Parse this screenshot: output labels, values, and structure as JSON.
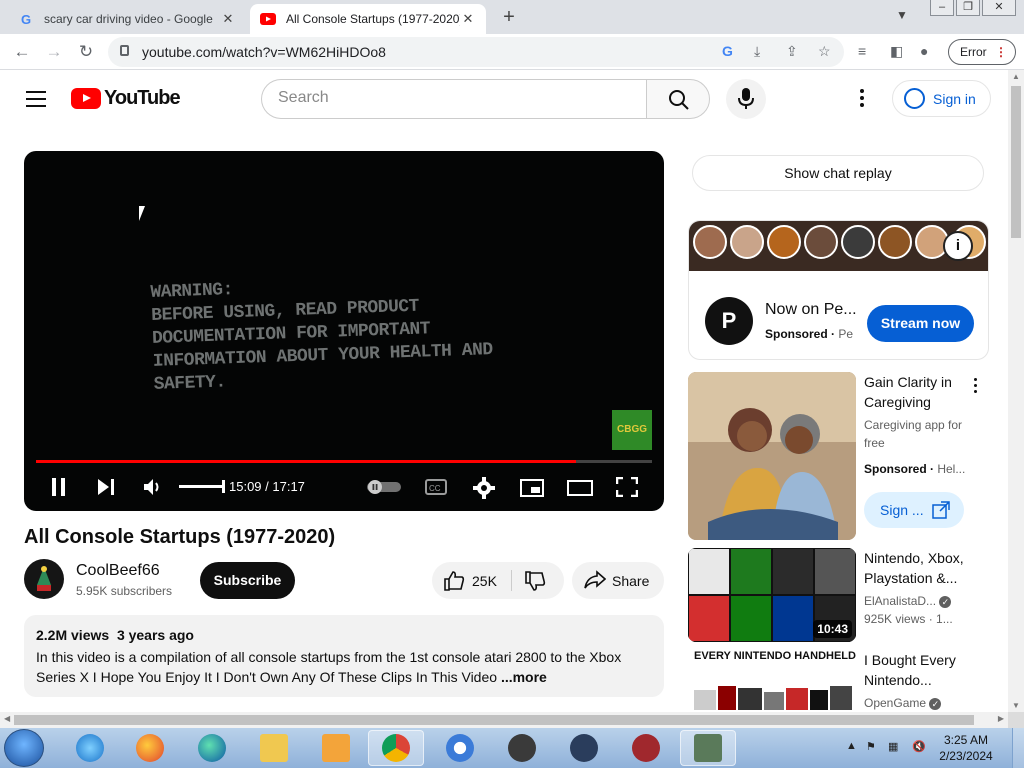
{
  "browser": {
    "tabs": [
      {
        "title": "scary car driving video - Google",
        "favicon": "google-g-icon"
      },
      {
        "title": "All Console Startups (1977-2020)",
        "favicon": "youtube-icon"
      }
    ],
    "url": "youtube.com/watch?v=WM62HiHDOo8",
    "profile_button": "Error"
  },
  "youtube": {
    "logo_text": "YouTube",
    "search_placeholder": "Search",
    "signin_label": "Sign in"
  },
  "player": {
    "warning_lines": [
      "WARNING:",
      "BEFORE USING, READ PRODUCT",
      "DOCUMENTATION FOR IMPORTANT",
      "INFORMATION ABOUT YOUR HEALTH AND",
      "SAFETY."
    ],
    "watermark": "CBGG",
    "time": "15:09 / 17:17",
    "progress_fraction": 0.876,
    "volume_fraction": 1.0
  },
  "video": {
    "title": "All Console Startups (1977-2020)",
    "channel": "CoolBeef66",
    "subscribers": "5.95K subscribers",
    "subscribe_label": "Subscribe",
    "likes": "25K",
    "share_label": "Share",
    "views": "2.2M views",
    "age": "3 years ago",
    "description": "In this video is a compilation of all console startups from the 1st console atari 2800 to the Xbox Series X I Hope You Enjoy It I Don't Own Any Of These Clips In This Video",
    "more_label": "...more"
  },
  "sidebar": {
    "chat_replay": "Show chat replay",
    "ad": {
      "title": "Now on Pe...",
      "sponsored": "Sponsored",
      "advertiser": "Pe",
      "button": "Stream now"
    },
    "recs": [
      {
        "title": "Gain Clarity in Caregiving",
        "line1": "Caregiving app for free",
        "sponsored": "Sponsored",
        "advertiser": "Hel...",
        "button": "Sign ..."
      },
      {
        "title": "Nintendo, Xbox, Playstation &...",
        "channel": "ElAnalistaD...",
        "meta": "925K views",
        "meta2": "1...",
        "duration": "10:43"
      },
      {
        "title": "I Bought Every Nintendo...",
        "channel": "OpenGame",
        "thumb_caption": "EVERY NINTENDO HANDHELD"
      }
    ]
  },
  "taskbar": {
    "time": "3:25 AM",
    "date": "2/23/2024"
  },
  "colors": {
    "youtube_red": "#ff0000",
    "link_blue": "#065fd4",
    "progress_red": "#ff0000"
  }
}
